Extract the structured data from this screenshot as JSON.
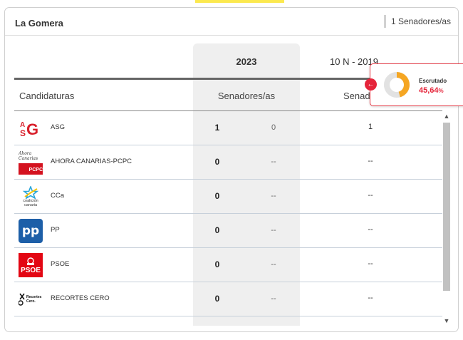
{
  "section": {
    "title": "La Gomera",
    "seats": "1 Senadores/as"
  },
  "years": {
    "current": "2023",
    "previous": "10 N - 2019"
  },
  "headers": {
    "candidaturas": "Candidaturas",
    "senadores_current": "Senadores/as",
    "senadores_prev_partial": "Senad"
  },
  "rows": [
    {
      "name": "ASG",
      "v1": "1",
      "v2": "0",
      "v3": "1"
    },
    {
      "name": "AHORA CANARIAS-PCPC",
      "v1": "0",
      "v2": "--",
      "v3": "--"
    },
    {
      "name": "CCa",
      "v1": "0",
      "v2": "--",
      "v3": "--"
    },
    {
      "name": "PP",
      "v1": "0",
      "v2": "--",
      "v3": "--"
    },
    {
      "name": "PSOE",
      "v1": "0",
      "v2": "--",
      "v3": "--"
    },
    {
      "name": "RECORTES CERO",
      "v1": "0",
      "v2": "--",
      "v3": "--"
    }
  ],
  "logos": {
    "asg_a": "A",
    "asg_s": "S",
    "asg_g": "G",
    "ahora_text": "Ahora Canarias",
    "pcpc_text": "PCPC",
    "cc_line1": "coalición",
    "cc_line2": "canaria",
    "pp_text": "pp",
    "psoe_text": "PSOE",
    "recortes_line1": "Recortes",
    "recortes_line2": "Cero."
  },
  "escrutado": {
    "label": "Escrutado",
    "percent": "45,64",
    "percent_sign": "%",
    "fraction": 0.4564
  },
  "colors": {
    "accent_red": "#e5243a",
    "donut_orange": "#f5a623",
    "highlight_col": "#efefef"
  }
}
